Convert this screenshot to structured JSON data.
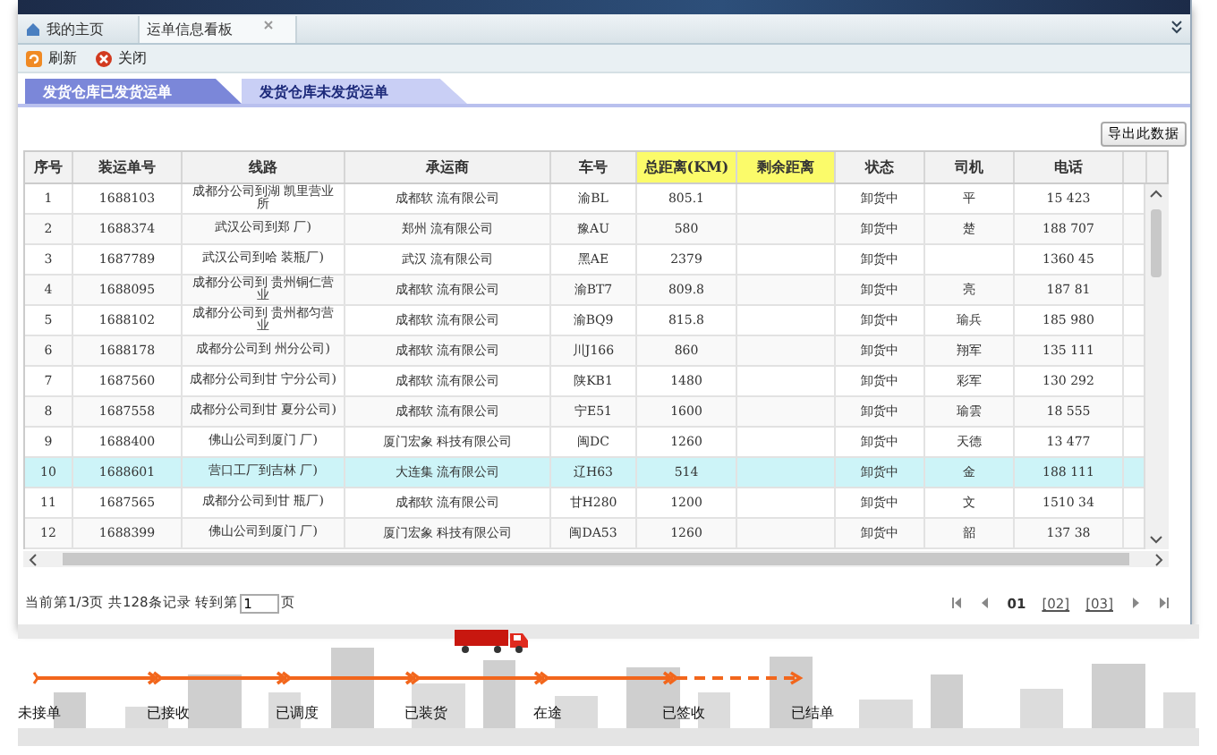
{
  "tabs": [
    {
      "label": "我的主页",
      "selected": false,
      "closable": false
    },
    {
      "label": "运单信息看板",
      "selected": true,
      "closable": true
    }
  ],
  "toolbar": [
    {
      "label": "刷新",
      "kind": "refresh"
    },
    {
      "label": "关闭",
      "kind": "close"
    }
  ],
  "subtabs": [
    {
      "label": "发货仓库已发货运单",
      "selected": true
    },
    {
      "label": "发货仓库未发货运单",
      "selected": false
    }
  ],
  "export_button": "导出此数据",
  "table": {
    "columns": [
      {
        "label": "序号",
        "highlighted": false
      },
      {
        "label": "装运单号",
        "highlighted": false
      },
      {
        "label": "线路",
        "highlighted": false
      },
      {
        "label": "承运商",
        "highlighted": false
      },
      {
        "label": "车号",
        "highlighted": false
      },
      {
        "label": "总距离(KM)",
        "highlighted": true
      },
      {
        "label": "剩余距离",
        "highlighted": true
      },
      {
        "label": "状态",
        "highlighted": false
      },
      {
        "label": "司机",
        "highlighted": false
      },
      {
        "label": "电话",
        "highlighted": false
      }
    ],
    "rows": [
      {
        "selected": false,
        "cells": [
          "1",
          "1688103",
          "成都分公司到湖 凯里营业所",
          "成都软 流有限公司",
          "渝BL",
          "805.1",
          "",
          "卸货中",
          "平",
          "15 423"
        ]
      },
      {
        "selected": false,
        "cells": [
          "2",
          "1688374",
          "武汉公司到郑 厂)",
          "郑州 流有限公司",
          "豫AU",
          "580",
          "",
          "卸货中",
          "楚",
          "188 707"
        ]
      },
      {
        "selected": false,
        "cells": [
          "3",
          "1687789",
          "武汉公司到哈 装瓶厂)",
          "武汉 流有限公司",
          "黑AE",
          "2379",
          "",
          "卸货中",
          "",
          "1360 45"
        ]
      },
      {
        "selected": false,
        "cells": [
          "4",
          "1688095",
          "成都分公司到 贵州铜仁营业",
          "成都软 流有限公司",
          "渝BT7",
          "809.8",
          "",
          "卸货中",
          "亮",
          "187 81"
        ]
      },
      {
        "selected": false,
        "cells": [
          "5",
          "1688102",
          "成都分公司到 贵州都匀营业",
          "成都软 流有限公司",
          "渝BQ9",
          "815.8",
          "",
          "卸货中",
          "瑜兵",
          "185 980"
        ]
      },
      {
        "selected": false,
        "cells": [
          "6",
          "1688178",
          "成都分公司到 州分公司)",
          "成都软 流有限公司",
          "川J166",
          "860",
          "",
          "卸货中",
          "翔军",
          "135 111"
        ]
      },
      {
        "selected": false,
        "cells": [
          "7",
          "1687560",
          "成都分公司到甘 宁分公司)",
          "成都软 流有限公司",
          "陕KB1",
          "1480",
          "",
          "卸货中",
          "彩军",
          "130 292"
        ]
      },
      {
        "selected": false,
        "cells": [
          "8",
          "1687558",
          "成都分公司到甘 夏分公司)",
          "成都软 流有限公司",
          "宁E51",
          "1600",
          "",
          "卸货中",
          "瑜雲",
          "18 555"
        ]
      },
      {
        "selected": false,
        "cells": [
          "9",
          "1688400",
          "佛山公司到厦门 厂)",
          "厦门宏象 科技有限公司",
          "闽DC",
          "1260",
          "",
          "卸货中",
          "天德",
          "13 477"
        ]
      },
      {
        "selected": true,
        "cells": [
          "10",
          "1688601",
          "营口工厂到吉林 厂)",
          "大连集 流有限公司",
          "辽H63",
          "514",
          "",
          "卸货中",
          "金",
          "188 111"
        ]
      },
      {
        "selected": false,
        "cells": [
          "11",
          "1687565",
          "成都分公司到甘 瓶厂)",
          "成都软 流有限公司",
          "甘H280",
          "1200",
          "",
          "卸货中",
          "文",
          "1510 34"
        ]
      },
      {
        "selected": false,
        "cells": [
          "12",
          "1688399",
          "佛山公司到厦门 厂)",
          "厦门宏象 科技有限公司",
          "闽DA53",
          "1260",
          "",
          "卸货中",
          "韶",
          "137 38"
        ]
      }
    ]
  },
  "pager": {
    "summary": "当前第1/3页 共128条记录 转到第",
    "page_input": "1",
    "suffix": "页",
    "pages": [
      {
        "label": "01",
        "selected": true
      },
      {
        "label": "[02]",
        "selected": false
      },
      {
        "label": "[03]",
        "selected": false
      }
    ]
  },
  "progress": {
    "steps": [
      {
        "label": "未接单"
      },
      {
        "label": "已接收"
      },
      {
        "label": "已调度"
      },
      {
        "label": "已装货"
      },
      {
        "label": "在途"
      },
      {
        "label": "已签收"
      },
      {
        "label": "已结单"
      }
    ],
    "segments": [
      {
        "dashed": false,
        "truck": false
      },
      {
        "dashed": false,
        "truck": false
      },
      {
        "dashed": false,
        "truck": false
      },
      {
        "dashed": false,
        "truck": true
      },
      {
        "dashed": false,
        "truck": false
      },
      {
        "dashed": true,
        "truck": false
      }
    ]
  }
}
